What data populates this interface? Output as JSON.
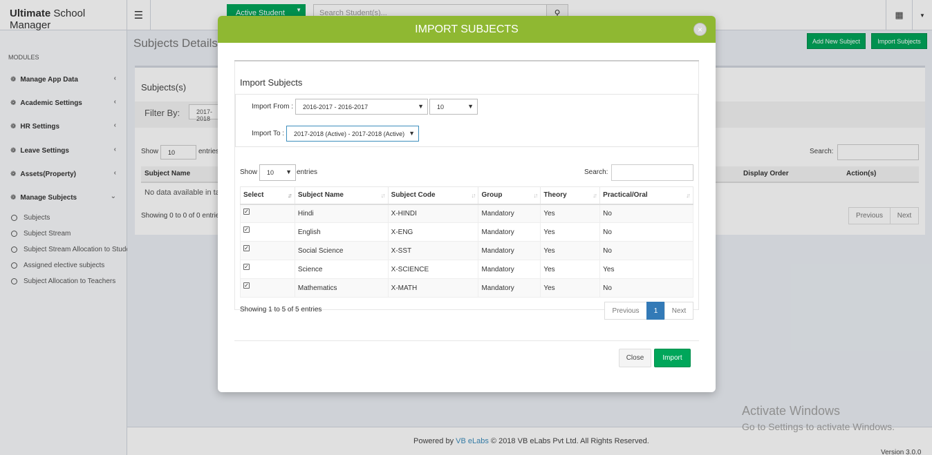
{
  "app": {
    "brand_bold": "Ultimate",
    "brand_rest": " School Manager"
  },
  "topbar": {
    "active_student_label": "Active Student",
    "search_placeholder": "Search Student(s)..."
  },
  "sidebar": {
    "section_label": "MODULES",
    "items": [
      {
        "label": "Manage App Data"
      },
      {
        "label": "Academic Settings"
      },
      {
        "label": "HR Settings"
      },
      {
        "label": "Leave Settings"
      },
      {
        "label": "Assets(Property)"
      },
      {
        "label": "Manage Subjects"
      }
    ],
    "subitems": [
      {
        "label": "Subjects"
      },
      {
        "label": "Subject Stream"
      },
      {
        "label": "Subject Stream Allocation to Students"
      },
      {
        "label": "Assigned elective subjects"
      },
      {
        "label": "Subject Allocation to Teachers"
      }
    ]
  },
  "page": {
    "title": "Subjects Details",
    "add_button": "Add New Subject",
    "import_button": "Import Subjects",
    "box_title": "Subjects(s)",
    "filter_label": "Filter By:",
    "filter_value": "2017-2018",
    "show_label": "Show",
    "show_value": "10",
    "entries_label": "entries",
    "search_label": "Search:",
    "columns": [
      "Subject Name",
      "Display Order",
      "Action(s)"
    ],
    "no_data": "No data available in table",
    "showing": "Showing 0 to 0 of 0 entries",
    "prev": "Previous",
    "next": "Next"
  },
  "footer": {
    "powered": "Powered by ",
    "company_link": "VB eLabs",
    "copyright": " © 2018 VB eLabs Pvt Ltd. All Rights Reserved.",
    "version": "Version 3.0.0"
  },
  "windows_watermark": {
    "title": "Activate Windows",
    "subtitle": "Go to Settings to activate Windows."
  },
  "modal": {
    "title": "IMPORT SUBJECTS",
    "close_icon": "×",
    "section_title": "Import Subjects",
    "import_from_label": "Import From :",
    "import_from_value": "2016-2017 - 2016-2017",
    "class_value": "10",
    "import_to_label": "Import To :",
    "import_to_value": "2017-2018 (Active) - 2017-2018 (Active)",
    "show_label": "Show",
    "show_value": "10",
    "entries_label": "entries",
    "search_label": "Search:",
    "table": {
      "columns": [
        "Select",
        "Subject Name",
        "Subject Code",
        "Group",
        "Theory",
        "Practical/Oral"
      ],
      "rows": [
        {
          "selected": true,
          "name": "Hindi",
          "code": "X-HINDI",
          "group": "Mandatory",
          "theory": "Yes",
          "practical": "No"
        },
        {
          "selected": true,
          "name": "English",
          "code": "X-ENG",
          "group": "Mandatory",
          "theory": "Yes",
          "practical": "No"
        },
        {
          "selected": true,
          "name": "Social Science",
          "code": "X-SST",
          "group": "Mandatory",
          "theory": "Yes",
          "practical": "No"
        },
        {
          "selected": true,
          "name": "Science",
          "code": "X-SCIENCE",
          "group": "Mandatory",
          "theory": "Yes",
          "practical": "Yes"
        },
        {
          "selected": true,
          "name": "Mathematics",
          "code": "X-MATH",
          "group": "Mandatory",
          "theory": "Yes",
          "practical": "No"
        }
      ]
    },
    "showing": "Showing 1 to 5 of 5 entries",
    "pagination": {
      "prev": "Previous",
      "page": "1",
      "next": "Next"
    },
    "close_button": "Close",
    "import_button": "Import"
  },
  "colors": {
    "modal_header": "#8fb832",
    "primary_green": "#00a65a",
    "pagination_active": "#337ab7"
  }
}
